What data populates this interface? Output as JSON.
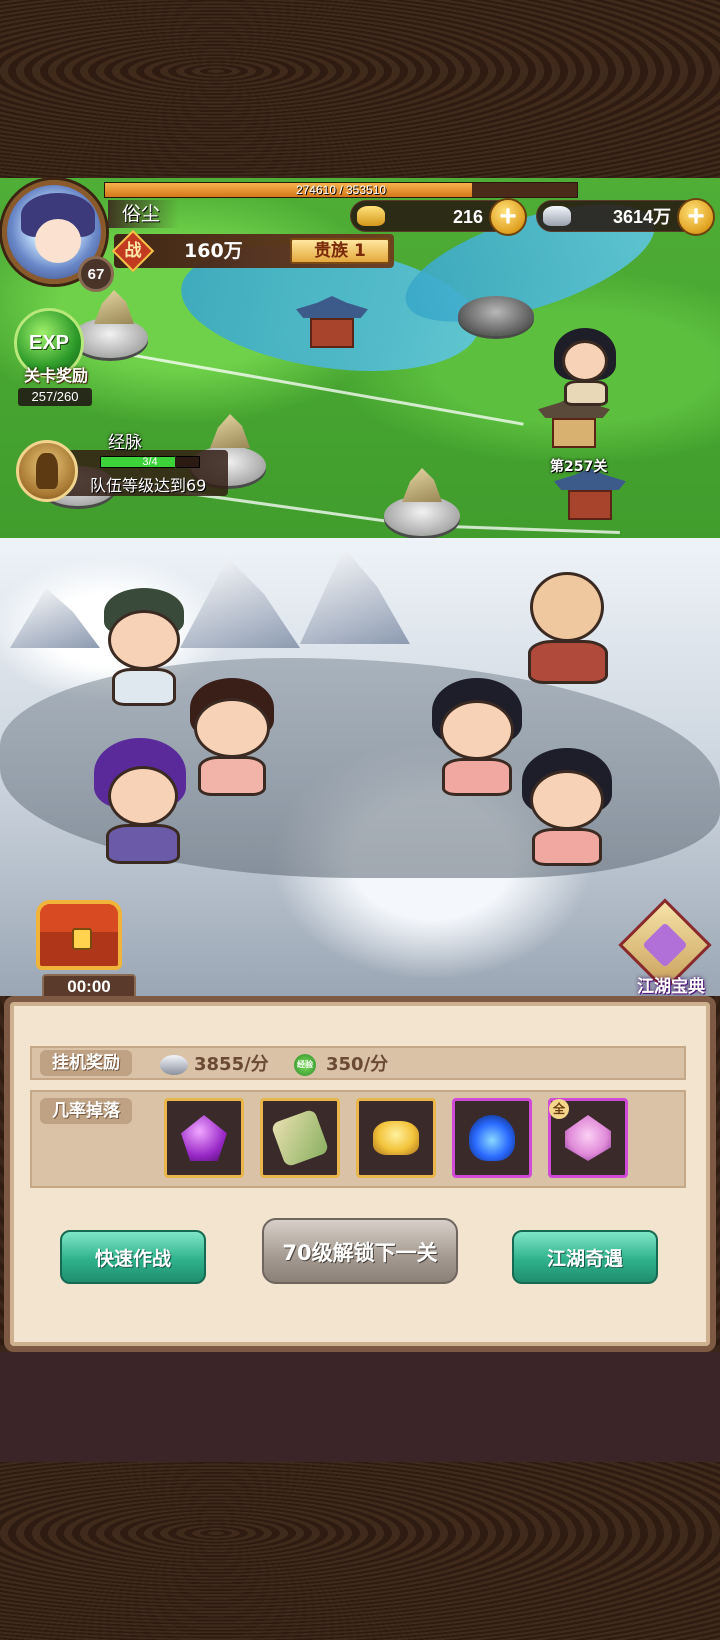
{
  "player": {
    "name": "俗尘",
    "level": "67",
    "exp_text": "274610 / 353510",
    "exp_fraction": 0.777,
    "power_icon_label": "战",
    "power": "160万",
    "rank": "贵族 1"
  },
  "currencies": {
    "gold": {
      "value": "216",
      "icon": "gold-ingot-icon",
      "color": "#f2c23a"
    },
    "silver": {
      "value": "3614万",
      "icon": "silver-ingot-icon",
      "color": "#c8ccd4"
    },
    "plus_label": "+"
  },
  "side": {
    "exp_orb_text": "EXP",
    "stage_reward_label": "关卡奖励",
    "stage_reward_count": "257/260",
    "meridian_title": "经脉",
    "meridian_progress": "3/4",
    "meridian_fraction": 0.75,
    "meridian_requirement": "队伍等级达到69"
  },
  "map": {
    "current_stage_label": "第257关"
  },
  "chest": {
    "timer": "00:00"
  },
  "codex": {
    "label": "江湖宝典"
  },
  "panel": {
    "idle_reward_label": "挂机奖励",
    "idle_silver": "3855/分",
    "idle_exp_icon_text": "经验",
    "idle_exp": "350/分",
    "drop_label": "几率掉落",
    "drops": [
      {
        "icon": "purple-gem-icon",
        "color": "#b04ae0",
        "rarity": "gold"
      },
      {
        "icon": "scroll-icon",
        "color": "#8ab060",
        "rarity": "gold"
      },
      {
        "icon": "gold-ingot-icon",
        "color": "#f2c23a",
        "rarity": "gold"
      },
      {
        "icon": "blue-soul-icon",
        "color": "#2a6aff",
        "rarity": "purple"
      },
      {
        "icon": "pink-treasure-icon",
        "color": "#e08ad8",
        "rarity": "purple",
        "tag": "全"
      }
    ],
    "quick_battle_label": "快速作战",
    "unlock_label": "70级解锁下一关",
    "adventure_label": "江湖奇遇"
  }
}
